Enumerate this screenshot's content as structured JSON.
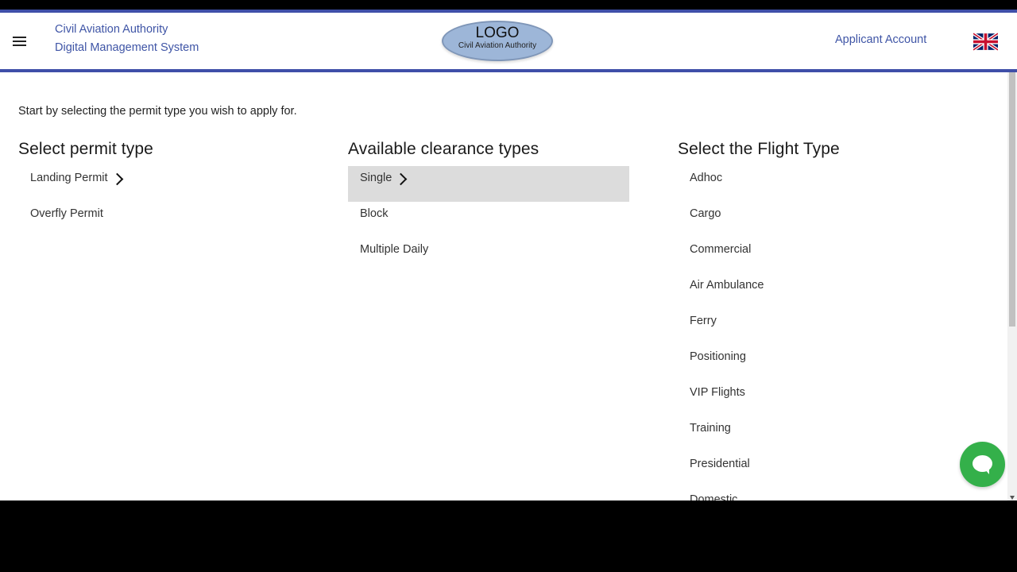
{
  "header": {
    "brand_line1": "Civil Aviation Authority",
    "brand_line2": "Digital Management System",
    "logo_main": "LOGO",
    "logo_sub": "Civil Aviation Authority",
    "account_label": "Applicant Account",
    "language_flag": "uk-flag-icon"
  },
  "colors": {
    "brand": "#3f55a6",
    "accent_bar": "#3f4fa8",
    "selected_row": "#dcdcdc",
    "chat_button": "#34b04a"
  },
  "intro_text": "Start by selecting the permit type you wish to apply for.",
  "permit": {
    "title": "Select permit type",
    "items": [
      "Landing Permit",
      "Overfly Permit"
    ],
    "selected": "Landing Permit"
  },
  "clearance": {
    "title": "Available clearance types",
    "items": [
      "Single",
      "Block",
      "Multiple Daily"
    ],
    "selected": "Single"
  },
  "flight": {
    "title": "Select the Flight Type",
    "items": [
      "Adhoc",
      "Cargo",
      "Commercial",
      "Air Ambulance",
      "Ferry",
      "Positioning",
      "VIP Flights",
      "Training",
      "Presidential",
      "Domestic"
    ]
  }
}
